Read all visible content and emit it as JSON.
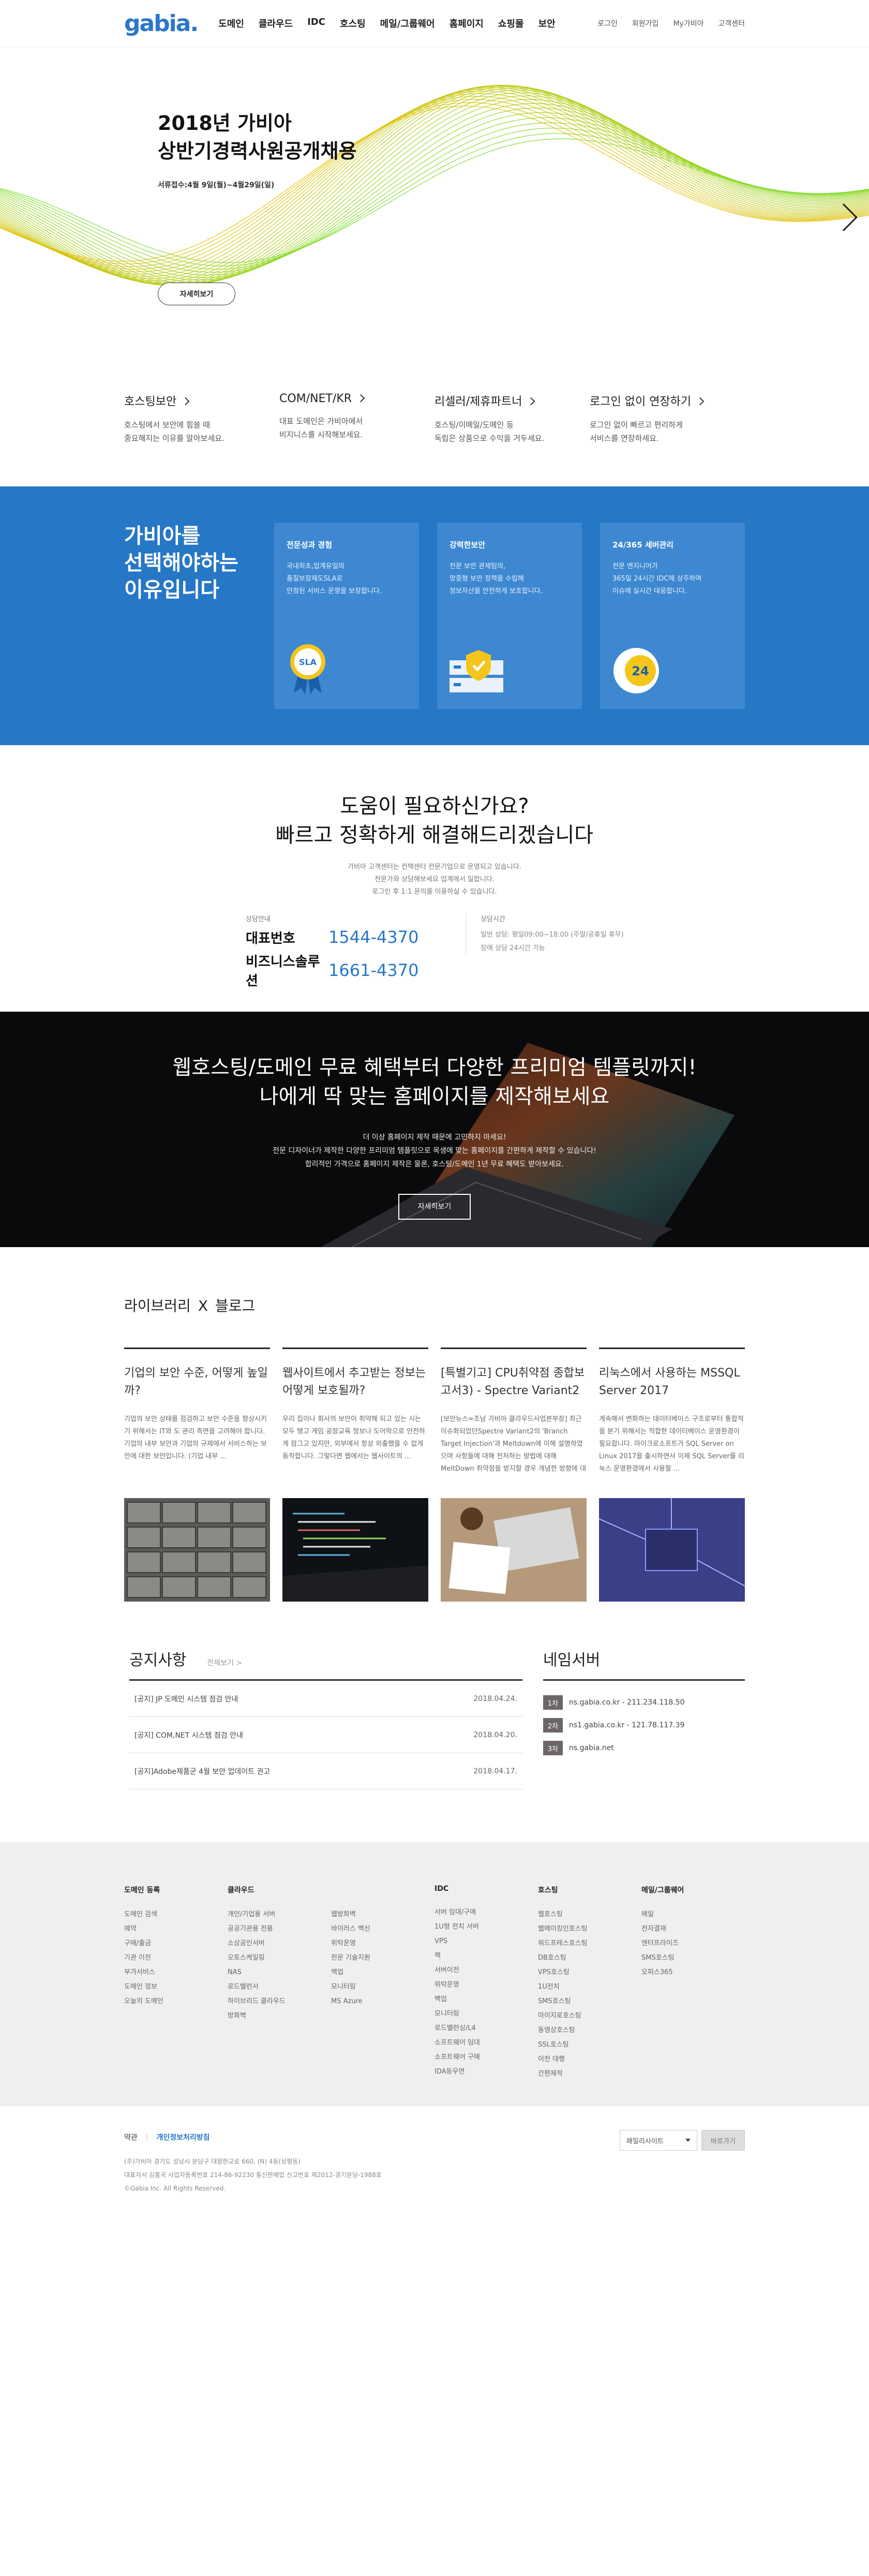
{
  "colors": {
    "brand": "#2677c6",
    "dark": "#0a0a0c",
    "footer_bg": "#efefef"
  },
  "header": {
    "logo": "gabia.",
    "nav": [
      "도메인",
      "클라우드",
      "IDC",
      "호스팅",
      "메일/그룹웨어",
      "홈페이지",
      "쇼핑몰",
      "보안"
    ],
    "util": [
      "로그인",
      "회원가입",
      "My가비아",
      "고객센터"
    ]
  },
  "hero": {
    "title_line1": "2018년 가비아",
    "title_line2": "상반기경력사원공개채용",
    "period": "서류접수:4월 9일(월)~4월29일(일)",
    "button": "자세히보기"
  },
  "quick": [
    {
      "title": "호스팅보안",
      "desc1": "호스팅에서 보안에 힘쓸 때",
      "desc2": "중요해지는 이유를 알아보세요."
    },
    {
      "title": "COM/NET/KR",
      "desc1": "대표 도메인은 가비아에서",
      "desc2": "비지니스를 시작해보세요."
    },
    {
      "title": "리셀러/제휴파트너",
      "desc1": "호스팅/이메일/도메인 등",
      "desc2": "독립은 상품으로 수익을 거두세요."
    },
    {
      "title": "로그인 없이 연장하기",
      "desc1": "로그인 없이 빠르고 편리하게",
      "desc2": "서비스를 연장하세요."
    }
  ],
  "why": {
    "title_line1": "가비아를",
    "title_line2": "선택해야하는",
    "title_line3": "이유입니다",
    "cards": [
      {
        "title": "전문성과 경험",
        "l1": "국내최초,업계유일의",
        "l2": "품질보장제도SLA로",
        "l3": "안정된 서비스 운영을 보장합니다.",
        "badge": "SLA"
      },
      {
        "title": "강력한보안",
        "l1": "전문 보안 관제팀의,",
        "l2": "망중형 보안 정책을 수립해",
        "l3": "정보자산을 안전하게 보호합니다.",
        "badge": ""
      },
      {
        "title": "24/365 세버관리",
        "l1": "전문 엔지니어가",
        "l2": "365일 24시간 IDC에 상주하며",
        "l3": "이슈에 실시간 대응합니다.",
        "badge": "24"
      }
    ]
  },
  "help": {
    "title_line1": "도움이 필요하신가요?",
    "title_line2": "빠르고 정확하게 해결해드리겠습니다",
    "sub1": "가비아 고객센터는 컨택센터 전문기업으로 운영되고 있습니다.",
    "sub2": "전문가와 상담해보세요 업계에서 일합니다.",
    "sub3": "로그인 후 1:1 문의를 이용하실 수 있습니다.",
    "contact_label": "상담안내",
    "rep_label": "대표번호",
    "rep_number": "1544-4370",
    "biz_label": "비즈니스솔루션",
    "biz_number": "1661-4370",
    "hours_label": "상담시간",
    "hours1": "일반 상담: 평일09:00~18:00 (주말/공휴일 휴무)",
    "hours2": "장애 상담 24시간 가능"
  },
  "promo": {
    "title_line1": "웹호스팅/도메인 무료 혜택부터 다양한 프리미엄 템플릿까지!",
    "title_line2": "나에게 딱 맞는 홈페이지를 제작해보세요",
    "desc1": "더 이상 홈페이지 제작 때문에 고민하지 마세요!",
    "desc2": "전문 디자이너가 제작한 다양한 프리미엄 템플릿으로 목생에 맞는 홈페이지를 간편하게 제작할 수 있습니다!",
    "desc3": "합리적인 가격으로 홈페이지 제작은 물론, 호스팅/도메인 1년 무료 혜택도 받아보세요.",
    "button": "자세히보기"
  },
  "library": {
    "title_a": "라이브러리",
    "title_x": "X",
    "title_b": "블로그",
    "posts": [
      {
        "title": "기업의 보안 수준, 어떻게 높일 까?",
        "body": "기업의 보안 상태를 점검하고 보안 수준을 향상시키기 위해서는 IT와 도 관리 측면을 고려해야 합니다. 기업의 내부 보안과 기업의 규제에서 서비스하는 보안에 대한 보안입니다. (기업 내부 ..."
      },
      {
        "title": "웹사이트에서 추고받는 정보는 어떻게 보호될까?",
        "body": "우리 집이나 회사의 보안이 취약해 되고 있는 시는 모두 탱고 게임 굉장교육 정보나 도어락으로 안전하게 잠그고 있지만, 외부에서 항상 외출했을 수 없게 동작합니다. 그렇다면 웹에서는 웹사이트의 ..."
      },
      {
        "title": "[특별기고] CPU취약점 종합보고서3) - Spectre Variant2",
        "body": "[보안뉴스=조남 가비아 클라우드사업본부장] 최근 이슈화되었던Spectre Variant2의 'Branch Target Injection'과 Meltdown에 이해 설명하였으며 사항들에 대해 전처하는 방법에 대해 MeltDown 취약점을 방지할 경우 개념한 방향에 대해서는 ..."
      },
      {
        "title": "리눅스에서 사용하는 MSSQL Server 2017",
        "body": "계속해서 변화하는 데이터베이스 구조로부터 통합적을 분기 위해서는 적합한 데이터베이스 운영환경이 필요합니다. 마이크로소프트가 SQL Server on Linux 2017을 출시하면서 이제 SQL Server를 리눅스 운영환경에서 사용할 ..."
      }
    ]
  },
  "notice": {
    "title": "공지사항",
    "more": "전체보기 >",
    "items": [
      {
        "text": "[공지] JP 도메인 시스템 점검 안내",
        "date": "2018.04.24."
      },
      {
        "text": "[공지] COM,NET 시스템 점검 안내",
        "date": "2018.04.20."
      },
      {
        "text": "[공지]Adobe제품군 4월 보안 업데이트 권고",
        "date": "2018.04.17."
      }
    ]
  },
  "nameserver": {
    "title": "네임서버",
    "items": [
      {
        "n": "1차",
        "text": "ns.gabia.co.kr - 211.234.118.50"
      },
      {
        "n": "2차",
        "text": "ns1.gabia.co.kr - 121.78.117.39"
      },
      {
        "n": "3차",
        "text": "ns.gabia.net"
      }
    ]
  },
  "footer": {
    "cols": [
      {
        "title": "도메인 등록",
        "links": [
          "도메인 검색",
          "예약",
          "구매/출금",
          "기관 이전",
          "부가서비스",
          "도메인 정보",
          "오늘의 도메인"
        ]
      },
      {
        "title": "클라우드",
        "links": [
          "개인/기업용 서버",
          "공공기관용 전용",
          "소상공인서버",
          "오토스케일링",
          "NAS",
          "로드밸런서",
          "하이브리드 클라우드",
          "방화벽"
        ],
        "links2": [
          "웹방화벽",
          "바이러스 백신",
          "위탁운영",
          "전문 기술지원",
          "백업",
          "모니터링",
          "MS Azure"
        ]
      },
      {
        "title": "IDC",
        "links": [
          "서버 임대/구매",
          "1U형 전치 서버",
          "VPS",
          "랙",
          "서버이전",
          "위탁운영",
          "백업",
          "모니터링",
          "로드밸런싱/L4",
          "소프트웨어 임대",
          "소프트웨어 구매",
          "IDA등우연"
        ]
      },
      {
        "title": "호스팅",
        "links": [
          "웹호스팅",
          "웹메이킹인호스팅",
          "워드프레스호스팅",
          "DB호스팅",
          "VPS호스팅",
          "1U전치",
          "SMS호스팅",
          "마이지로호스팅",
          "동영상호스팅",
          "SSL호스팅",
          "이전 대행",
          "간편제작"
        ]
      },
      {
        "title": "메일/그룹웨어",
        "links": [
          "메일",
          "전자결재",
          "엔터프라이즈",
          "SMS호스팅",
          "오피스365"
        ]
      }
    ],
    "terms": "약관",
    "privacy": "개인정보처리방침",
    "info1": "(주)가비아     경기도 성남시 분당구 대왕판교로 660, (N) 4동(삼평동)",
    "info2": "대표자서 김홍국     사업자등록번호 214-86-92230     통신판매업 신고번호 제2012-경기분당-1988호",
    "copyright": "©Gabia Inc. All Rights Reserved.",
    "family_select": "패밀리사이트",
    "go": "바로가기"
  }
}
